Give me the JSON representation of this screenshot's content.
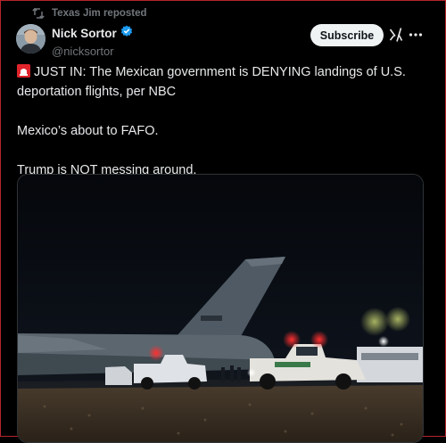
{
  "repost": {
    "text": "Texas Jim reposted",
    "icon": "repost-icon"
  },
  "author": {
    "name": "Nick Sortor",
    "handle": "@nicksortor",
    "verified_icon": "verified-badge-icon",
    "verified_color": "#1d9bf0"
  },
  "actions": {
    "subscribe_label": "Subscribe",
    "grok_icon": "grok-icon",
    "more_icon": "more-options-icon"
  },
  "tweet": {
    "line1_emoji": "siren-emoji",
    "line1": "JUST IN: The Mexican government is DENYING landings of U.S. deportation flights, per NBC",
    "line2": "Mexico’s about to FAFO.",
    "line3": "Trump is NOT messing around."
  },
  "media": {
    "description_icon": "night-airfield-photo"
  },
  "colors": {
    "background": "#000000",
    "text": "#e7e9ea",
    "muted": "#71767b",
    "accent": "#1d9bf0"
  }
}
